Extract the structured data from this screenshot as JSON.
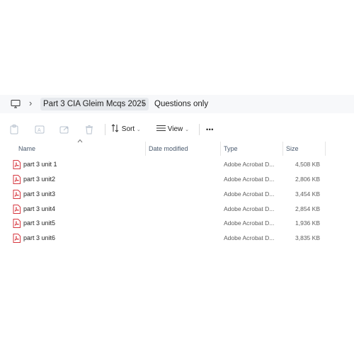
{
  "breadcrumb": {
    "computer_icon": "computer-icon",
    "items": [
      {
        "label": "Part 3 CIA Gleim Mcqs 2025"
      },
      {
        "label": "Questions only"
      }
    ]
  },
  "toolbar": {
    "sort_label": "Sort",
    "view_label": "View",
    "more_label": "•••"
  },
  "columns": {
    "name": "Name",
    "date_modified": "Date modified",
    "type": "Type",
    "size": "Size"
  },
  "files": [
    {
      "name": "part 3 unit 1",
      "type": "Adobe Acrobat D...",
      "size": "4,508 KB"
    },
    {
      "name": "part 3 unit2",
      "type": "Adobe Acrobat D...",
      "size": "2,806 KB"
    },
    {
      "name": "part 3 unit3",
      "type": "Adobe Acrobat D...",
      "size": "3,454 KB"
    },
    {
      "name": "part 3 unit4",
      "type": "Adobe Acrobat D...",
      "size": "2,854 KB"
    },
    {
      "name": "part 3 unit5",
      "type": "Adobe Acrobat D...",
      "size": "1,936 KB"
    },
    {
      "name": "part 3 unit6",
      "type": "Adobe Acrobat D...",
      "size": "3,835 KB"
    }
  ],
  "colors": {
    "pdf_red": "#d7373f",
    "header_text": "#4a5a6e",
    "address_bg": "#f7f8fa"
  }
}
